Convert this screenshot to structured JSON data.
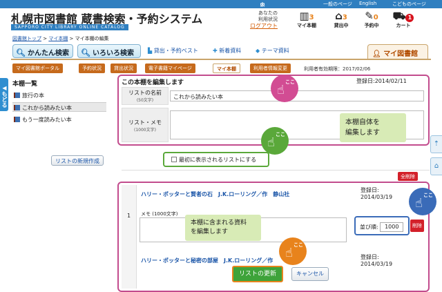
{
  "header": {
    "size_labels": [
      "大",
      "中",
      "小"
    ],
    "links": [
      "一般のページ",
      "English",
      "こどものページ"
    ],
    "title": "札幌市図書館 蔵書検索・予約システム",
    "subtitle": "SAPPORO CITY LIBRARY ONLINE CATALOG",
    "status_line1": "あなたの",
    "status_line2": "利用状況",
    "logout": "ログアウト",
    "icons": [
      {
        "icon": "bookshelf-icon",
        "count": "3",
        "label": "マイ本棚"
      },
      {
        "icon": "house-icon",
        "count": "3",
        "label": "貸出中"
      },
      {
        "icon": "pencil-icon",
        "count": "0",
        "label": "予約中"
      },
      {
        "icon": "cart-icon",
        "count": "1",
        "label": "カート"
      }
    ]
  },
  "breadcrumb": {
    "items": [
      "図書館トップ",
      "マイ本棚"
    ],
    "current": "マイ本棚の編集"
  },
  "search_tabs": [
    "かんたん検索",
    "いろいろ検索"
  ],
  "nav_links": [
    "貸出・予約ベスト",
    "新着資料",
    "テーマ資料"
  ],
  "mylibrary_tab": "マイ図書館",
  "sub_tabs": [
    "マイ図書館ポータル",
    "予約状況",
    "貸出状況",
    "電子書籍マイページ",
    "マイ本棚",
    "利用者情報変更"
  ],
  "expiry": "利用者有効期限：2017/02/06",
  "sidebar": {
    "back": "もどる",
    "heading": "本棚一覧",
    "items": [
      "旅行の本",
      "これから読みたい本",
      "もう一度読みたい本"
    ],
    "new_button": "リストの新規作成"
  },
  "edit": {
    "heading": "この本棚を編集します",
    "reg_date": "登録日:2014/02/11",
    "name_label": "リストの名前",
    "name_hint": "(50文字)",
    "name_value": "これから読みたい本",
    "memo_label": "リスト・メモ",
    "memo_hint": "(1000文字)",
    "checkbox_label": "最初に表示されるリストにする"
  },
  "annotations": {
    "koko": "ここ",
    "balloon1_l1": "本棚自体を",
    "balloon1_l2": "編集します",
    "balloon2_l1": "本棚に含まれる資料",
    "balloon2_l2": "を編集します"
  },
  "delete_all": "全削除",
  "items": [
    {
      "num": "1",
      "title": "ハリー・ポッターと賢者の石　J.K.ローリング／作　静山社",
      "date_label": "登録日:",
      "date": "2014/03/19",
      "memo_label": "メモ (1000文字)",
      "sort_label": "並び順:",
      "sort_value": "1000",
      "delete": "削除"
    },
    {
      "title": "ハリー・ポッターと秘密の部屋　J.K.ローリング／作",
      "date_label": "登録日:",
      "date": "2014/03/19"
    }
  ],
  "update_button": "リストの更新",
  "cancel_button": "キャンセル",
  "colors": {
    "accent": "#2f7fc0",
    "brand_orange": "#c66a1c",
    "highlight_pink": "#c24b8d",
    "highlight_green": "#5aa83a",
    "highlight_blue": "#3a6bb8",
    "delete_red": "#d3202a"
  }
}
